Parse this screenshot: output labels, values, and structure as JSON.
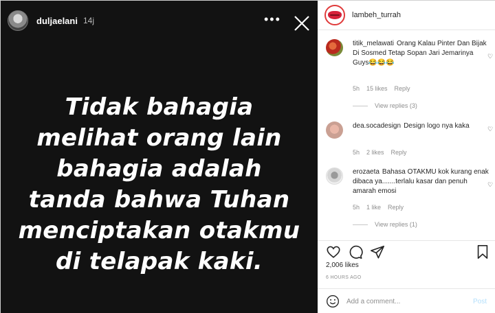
{
  "story": {
    "username": "duljaelani",
    "time": "14j",
    "menu_glyph": "•••",
    "text": "Tidak bahagia melihat orang lain bahagia adalah tanda bahwa Tuhan menciptakan otakmu di telapak kaki."
  },
  "post": {
    "account": "lambeh_turrah",
    "comments": [
      {
        "user": "titik_melawati",
        "text": "Orang Kalau Pinter Dan Bijak Di Sosmed Tetap Sopan Jari Jemarinya Guys😂😂😂",
        "time": "5h",
        "likes": "15 likes",
        "reply": "Reply",
        "view_replies": "View replies (3)"
      },
      {
        "user": "dea.socadesign",
        "text": "Design logo nya kaka",
        "time": "5h",
        "likes": "2 likes",
        "reply": "Reply"
      },
      {
        "user": "erozaeta",
        "text": "Bahasa OTAKMU kok kurang enak dibaca ya.......terlalu kasar dan penuh amarah emosi",
        "time": "5h",
        "likes": "1 like",
        "reply": "Reply",
        "view_replies": "View replies (1)"
      }
    ],
    "likes_count": "2,006 likes",
    "time_ago": "6 HOURS AGO",
    "add_comment_placeholder": "Add a comment...",
    "post_label": "Post"
  },
  "colors": {
    "story_bg": "#121212",
    "post_button": "#b2dffc",
    "brand_red": "#d6213a"
  },
  "icons": [
    "close-icon",
    "heart-icon",
    "comment-icon",
    "share-icon",
    "bookmark-icon",
    "smiley-icon"
  ]
}
